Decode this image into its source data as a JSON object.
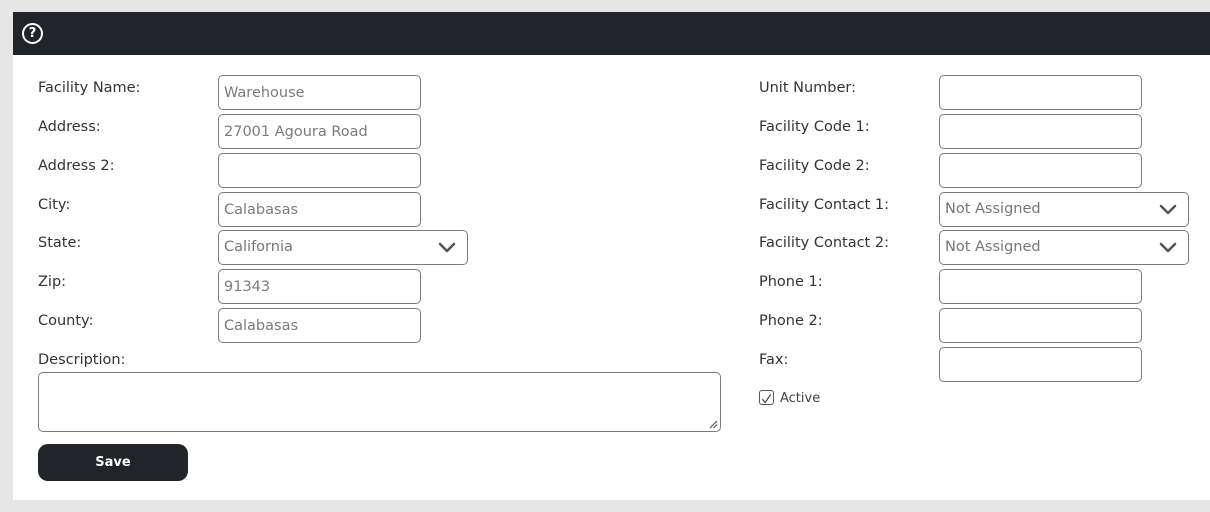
{
  "help": {
    "icon": "question-circle-icon",
    "glyph": "?"
  },
  "left": {
    "facility_name": {
      "label": "Facility Name:",
      "value": "Warehouse"
    },
    "address": {
      "label": "Address:",
      "value": "27001 Agoura Road"
    },
    "address2": {
      "label": "Address 2:",
      "value": ""
    },
    "city": {
      "label": "City:",
      "value": "Calabasas"
    },
    "state": {
      "label": "State:",
      "selected": "California"
    },
    "zip": {
      "label": "Zip:",
      "value": "91343"
    },
    "county": {
      "label": "County:",
      "value": "Calabasas"
    },
    "description": {
      "label": "Description:",
      "value": ""
    }
  },
  "right": {
    "unit_number": {
      "label": "Unit Number:",
      "value": ""
    },
    "facility_code1": {
      "label": "Facility Code 1:",
      "value": ""
    },
    "facility_code2": {
      "label": "Facility Code 2:",
      "value": ""
    },
    "facility_contact1": {
      "label": "Facility Contact 1:",
      "selected": "Not Assigned"
    },
    "facility_contact2": {
      "label": "Facility Contact 2:",
      "selected": "Not Assigned"
    },
    "phone1": {
      "label": "Phone 1:",
      "value": ""
    },
    "phone2": {
      "label": "Phone 2:",
      "value": ""
    },
    "fax": {
      "label": "Fax:",
      "value": ""
    },
    "active": {
      "label": "Active",
      "checked": true
    }
  },
  "actions": {
    "save_label": "Save"
  },
  "colors": {
    "bar": "#212428",
    "button": "#212428",
    "background": "#e6e6e6",
    "panel": "#ffffff"
  }
}
